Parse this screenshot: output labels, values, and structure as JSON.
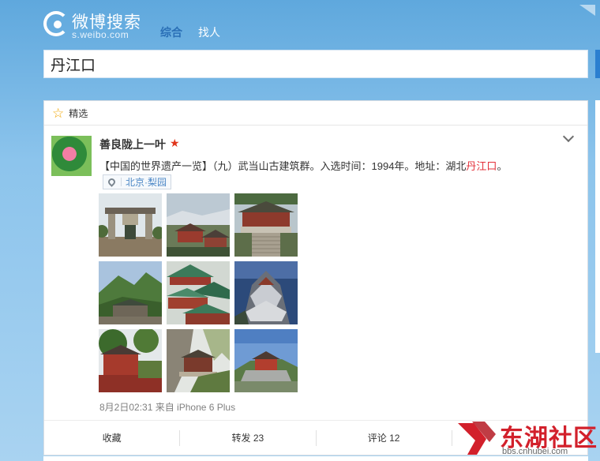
{
  "header": {
    "logo_title": "微博搜索",
    "logo_sub": "s.weibo.com",
    "nav": [
      {
        "label": "综合",
        "active": true
      },
      {
        "label": "找人",
        "active": false
      }
    ]
  },
  "search": {
    "value": "丹江口"
  },
  "card": {
    "section_label": "精选",
    "user_name": "善良陇上一叶",
    "text_main": "【中国的世界遗产一览】（九）武当山古建筑群。入选时间：1994年。地址：湖北",
    "text_highlight": "丹江口",
    "text_end": "。",
    "location": "北京·梨园",
    "time": "8月2日02:31 来自 iPhone 6 Plus",
    "photos": [
      {
        "label": "stone-archway-photo"
      },
      {
        "label": "temple-roofs-valley-photo"
      },
      {
        "label": "palace-hall-stairs-photo"
      },
      {
        "label": "mountain-temple-photo"
      },
      {
        "label": "green-tile-roofs-photo"
      },
      {
        "label": "cliff-temple-aerial-photo"
      },
      {
        "label": "red-walls-trees-photo"
      },
      {
        "label": "cliffside-pavilion-photo"
      },
      {
        "label": "summit-temple-photo"
      }
    ],
    "actions": [
      {
        "label": "收藏"
      },
      {
        "label": "转发 23"
      },
      {
        "label": "评论 12"
      },
      {
        "label": ""
      }
    ]
  },
  "watermark": {
    "text": "东湖社区",
    "url": "bbs.cnhubei.com"
  },
  "colors": {
    "accent": "#2a6fb6",
    "highlight": "#e3303a",
    "watermark_red": "#d2202b"
  }
}
